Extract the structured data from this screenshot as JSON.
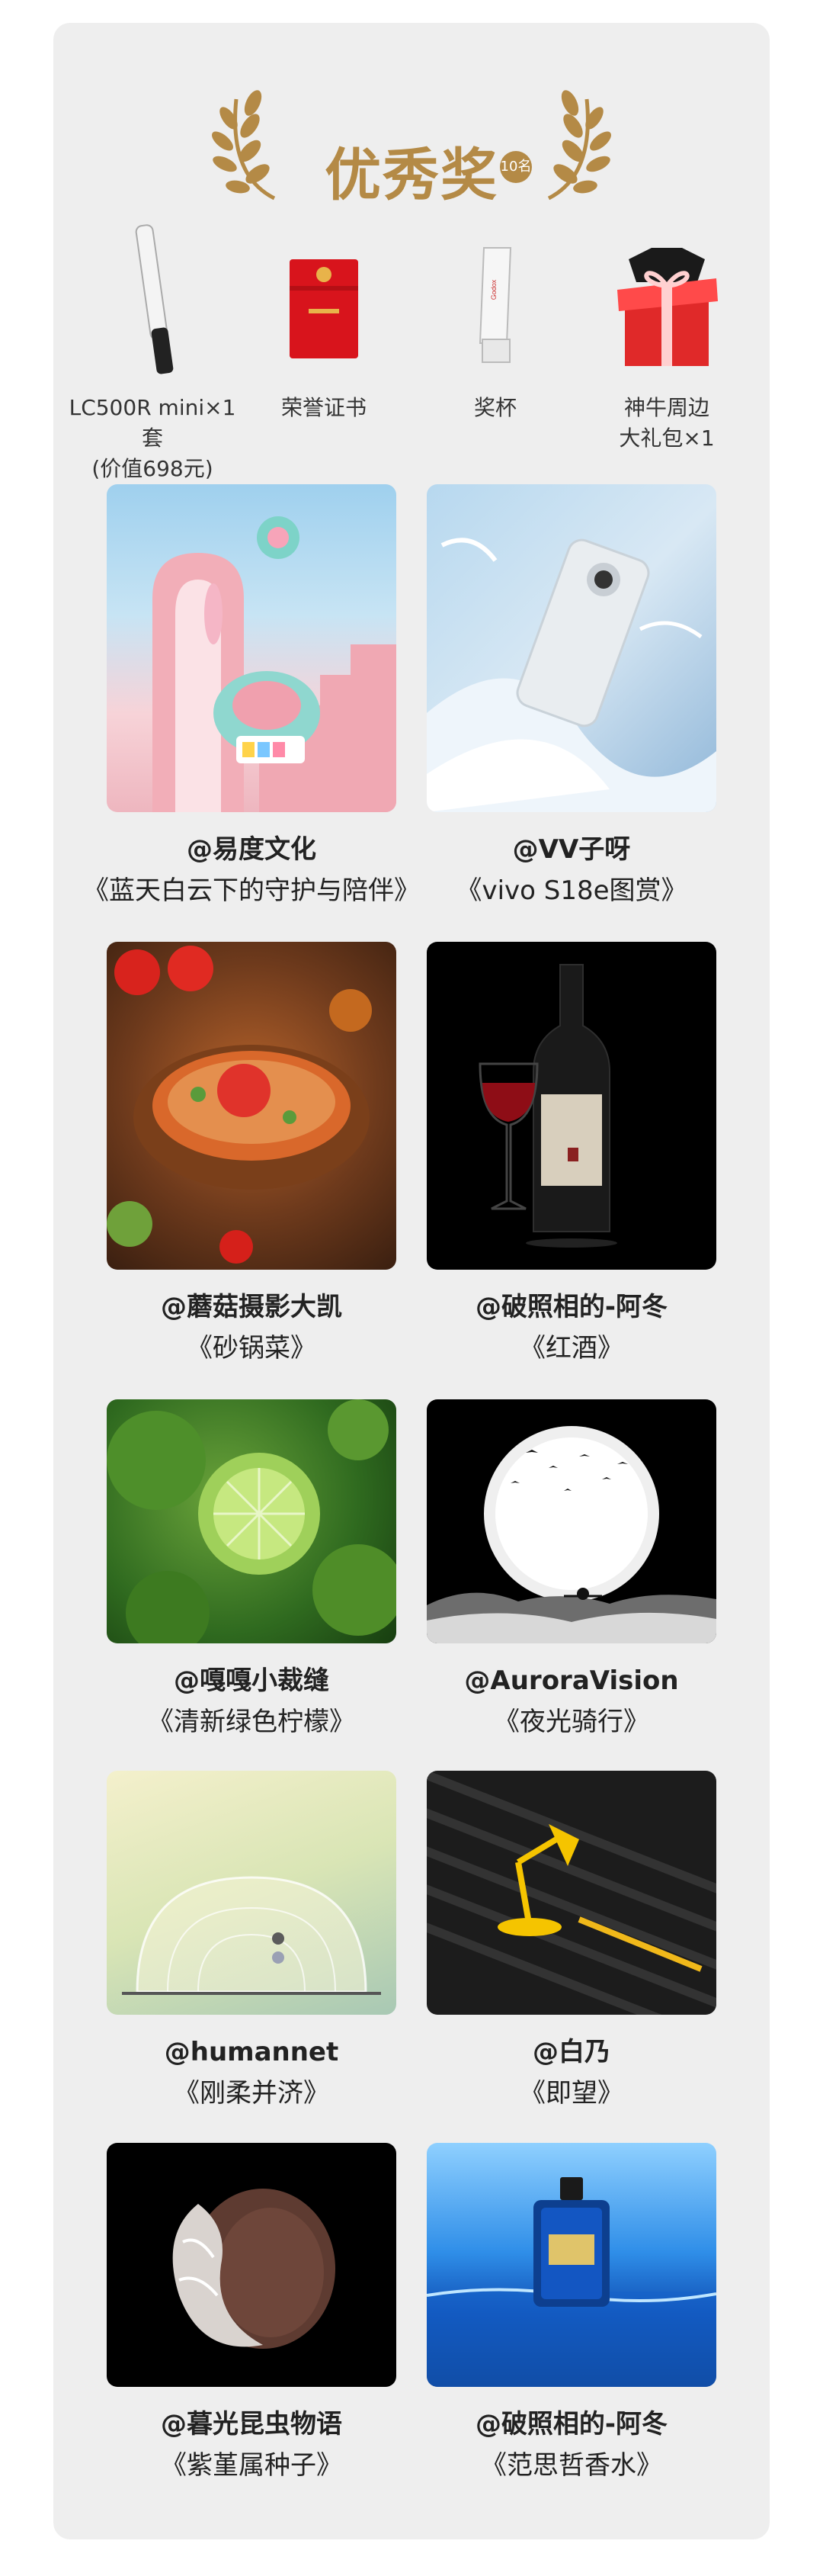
{
  "header": {
    "title": "优秀奖",
    "badge": "10名"
  },
  "prizes": [
    {
      "label": "LC500R mini×1套\n(价值698元)",
      "icon": "led-light-stick"
    },
    {
      "label": "荣誉证书",
      "icon": "certificate"
    },
    {
      "label": "奖杯",
      "icon": "trophy"
    },
    {
      "label": "神牛周边\n大礼包×1",
      "icon": "gift-box"
    }
  ],
  "prize_marks": {
    "trophy_brand": "Godox"
  },
  "winners": [
    {
      "author": "@易度文化",
      "work": "《蓝天白云下的守护与陪伴》"
    },
    {
      "author": "@VV子呀",
      "work": "《vivo S18e图赏》"
    },
    {
      "author": "@蘑菇摄影大凯",
      "work": "《砂锅菜》"
    },
    {
      "author": "@破照相的-阿冬",
      "work": "《红酒》"
    },
    {
      "author": "@嘎嘎小裁缝",
      "work": "《清新绿色柠檬》"
    },
    {
      "author": "@AuroraVision",
      "work": "《夜光骑行》"
    },
    {
      "author": "@humannet",
      "work": "《刚柔并济》"
    },
    {
      "author": "@白乃",
      "work": "《即望》"
    },
    {
      "author": "@暮光昆虫物语",
      "work": "《紫堇属种子》"
    },
    {
      "author": "@破照相的-阿冬",
      "work": "《范思哲香水》"
    }
  ],
  "colors": {
    "gold": "#b48a46",
    "card_bg": "#eeeeee",
    "text": "#222222"
  }
}
